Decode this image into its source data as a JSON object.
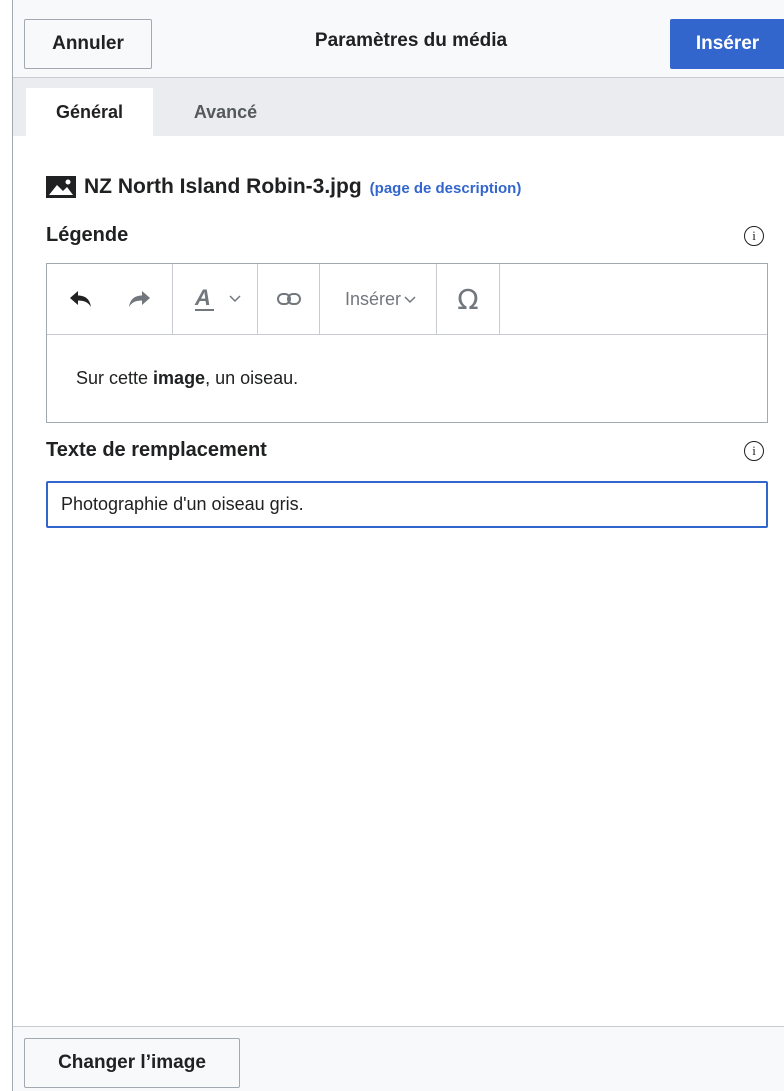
{
  "header": {
    "cancel_label": "Annuler",
    "title": "Paramètres du média",
    "insert_label": "Insérer",
    "primary_color": "#3366cc"
  },
  "tabs": [
    {
      "label": "Général",
      "active": true
    },
    {
      "label": "Avancé",
      "active": false
    }
  ],
  "file": {
    "icon": "image-icon",
    "name": "NZ North Island Robin-3.jpg",
    "description_link": "(page de description)"
  },
  "caption": {
    "label": "Légende",
    "info_icon": "info-icon",
    "toolbar": {
      "undo_icon": "undo-icon",
      "redo_icon": "redo-icon",
      "style_icon": "text-style-icon",
      "link_icon": "link-icon",
      "insert_label": "Insérer",
      "special_char": "Ω"
    },
    "content_before": "Sur cette ",
    "content_bold": "image",
    "content_after": ", un oiseau."
  },
  "alt_text": {
    "label": "Texte de remplacement",
    "info_icon": "info-icon",
    "value": "Photographie d'un oiseau gris."
  },
  "footer": {
    "change_image_label": "Changer l’image"
  }
}
